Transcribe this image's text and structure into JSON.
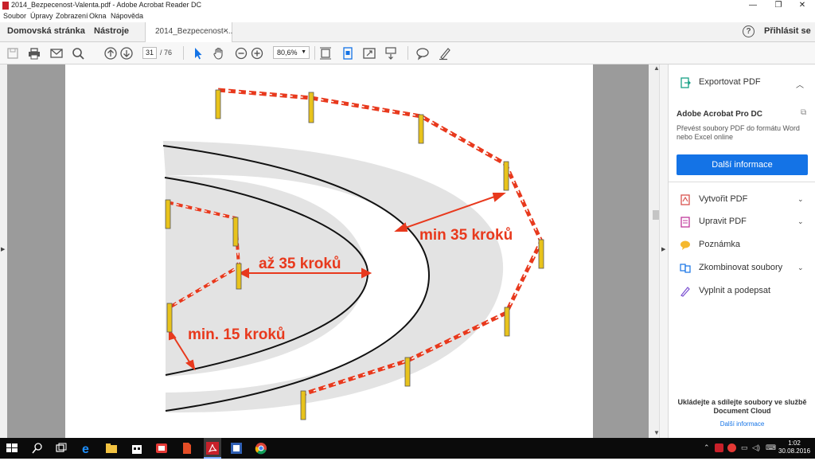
{
  "window": {
    "title": "2014_Bezpecenost-Valenta.pdf - Adobe Acrobat Reader DC",
    "minimize": "—",
    "maximize": "❐",
    "close": "✕"
  },
  "menu": [
    "Soubor",
    "Úpravy",
    "Zobrazení",
    "Okna",
    "Nápověda"
  ],
  "tabs": {
    "home": "Domovská stránka",
    "tools": "Nástroje",
    "document": "2014_Bezpecenost-...",
    "document_close": "×",
    "help": "?",
    "signin": "Přihlásit se"
  },
  "toolbar": {
    "page_current": "31",
    "page_total": "/ 76",
    "zoom": "80,6%"
  },
  "document": {
    "label_min35": "min 35 kroků",
    "label_az35": "až 35 kroků",
    "label_min15": "min. 15 kroků"
  },
  "right_pane": {
    "export": "Exportovat PDF",
    "product": "Adobe Acrobat Pro DC",
    "description": "Převést soubory PDF do formátu Word nebo Excel online",
    "more_button": "Další informace",
    "items": [
      "Vytvořit PDF",
      "Upravit PDF",
      "Poznámka",
      "Zkombinovat soubory",
      "Vyplnit a podepsat"
    ],
    "footer": "Ukládejte a sdílejte soubory ve službě Document Cloud",
    "footer_link": "Další informace"
  },
  "taskbar": {
    "time": "1:02",
    "date": "30.08.2016"
  },
  "colors": {
    "accent": "#1473e6",
    "tape_red": "#e8391d",
    "label_red": "#e8391d",
    "post_yellow": "#e8c31c"
  }
}
